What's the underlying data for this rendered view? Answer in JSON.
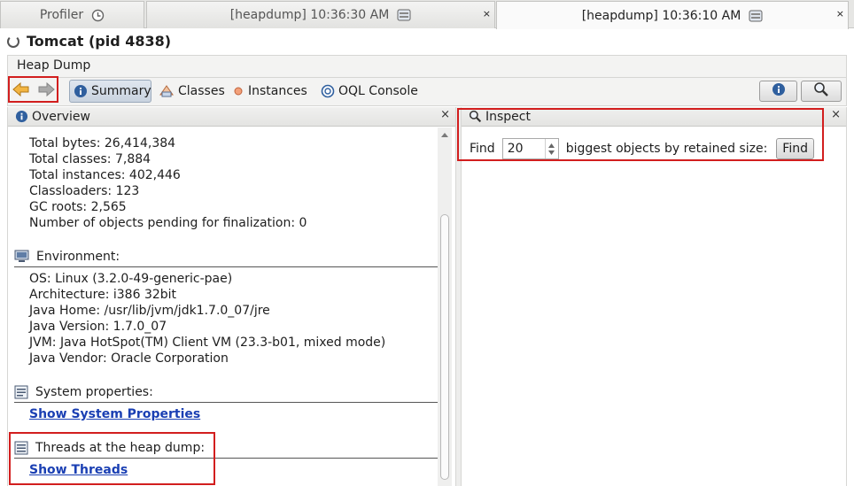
{
  "tabs": [
    {
      "label": "Profiler",
      "icon": "clock-icon",
      "active": false
    },
    {
      "label": "[heapdump] 10:36:30 AM",
      "icon": "heapdump-icon",
      "active": false
    },
    {
      "label": "[heapdump] 10:36:10 AM",
      "icon": "heapdump-icon",
      "active": true
    }
  ],
  "tab_close_glyph": "×",
  "process_title": "Tomcat (pid 4838)",
  "heap_dump_label": "Heap Dump",
  "toolbar": {
    "summary": "Summary",
    "classes": "Classes",
    "instances": "Instances",
    "oql_console": "OQL Console"
  },
  "overview": {
    "title": "Overview",
    "stats": [
      "Total bytes: 26,414,384",
      "Total classes: 7,884",
      "Total instances: 402,446",
      "Classloaders: 123",
      "GC roots: 2,565",
      "Number of objects pending for finalization: 0"
    ],
    "environment_title": "Environment:",
    "environment": [
      "OS: Linux (3.2.0-49-generic-pae)",
      "Architecture: i386 32bit",
      "Java Home: /usr/lib/jvm/jdk1.7.0_07/jre",
      "Java Version: 1.7.0_07",
      "JVM: Java HotSpot(TM) Client VM (23.3-b01, mixed mode)",
      "Java Vendor: Oracle Corporation"
    ],
    "system_properties_title": "System properties:",
    "show_system_properties": "Show System Properties",
    "threads_title": "Threads at the heap dump:",
    "show_threads": "Show Threads"
  },
  "inspect": {
    "title": "Inspect",
    "find_label": "Find",
    "count_value": "20",
    "suffix_label": "biggest objects by retained size:",
    "find_button": "Find"
  },
  "colors": {
    "highlight": "#d21e1e",
    "link": "#1a3fb3",
    "nav_arrow": "#e8a628",
    "info_icon": "#2f5f9e"
  }
}
